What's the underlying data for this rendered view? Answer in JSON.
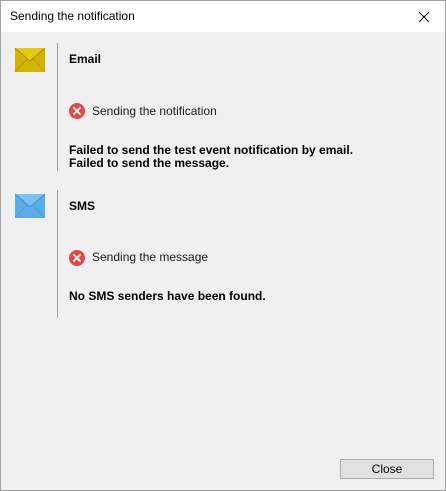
{
  "window": {
    "title": "Sending the notification"
  },
  "email": {
    "title": "Email",
    "icon": "envelope-icon",
    "icon_color": "#d4b300",
    "status_text": "Sending the notification",
    "status_icon": "error-icon",
    "message_lines": [
      "Failed to send the test event notification by email.",
      "Failed to send the message."
    ]
  },
  "sms": {
    "title": "SMS",
    "icon": "envelope-icon",
    "icon_color": "#5aaee8",
    "status_text": "Sending the message",
    "status_icon": "error-icon",
    "message_lines": [
      "No SMS senders have been found."
    ]
  },
  "buttons": {
    "close_label": "Close"
  },
  "colors": {
    "error": "#e0484b",
    "email_envelope": "#d4b300",
    "sms_envelope": "#5aaee8"
  }
}
